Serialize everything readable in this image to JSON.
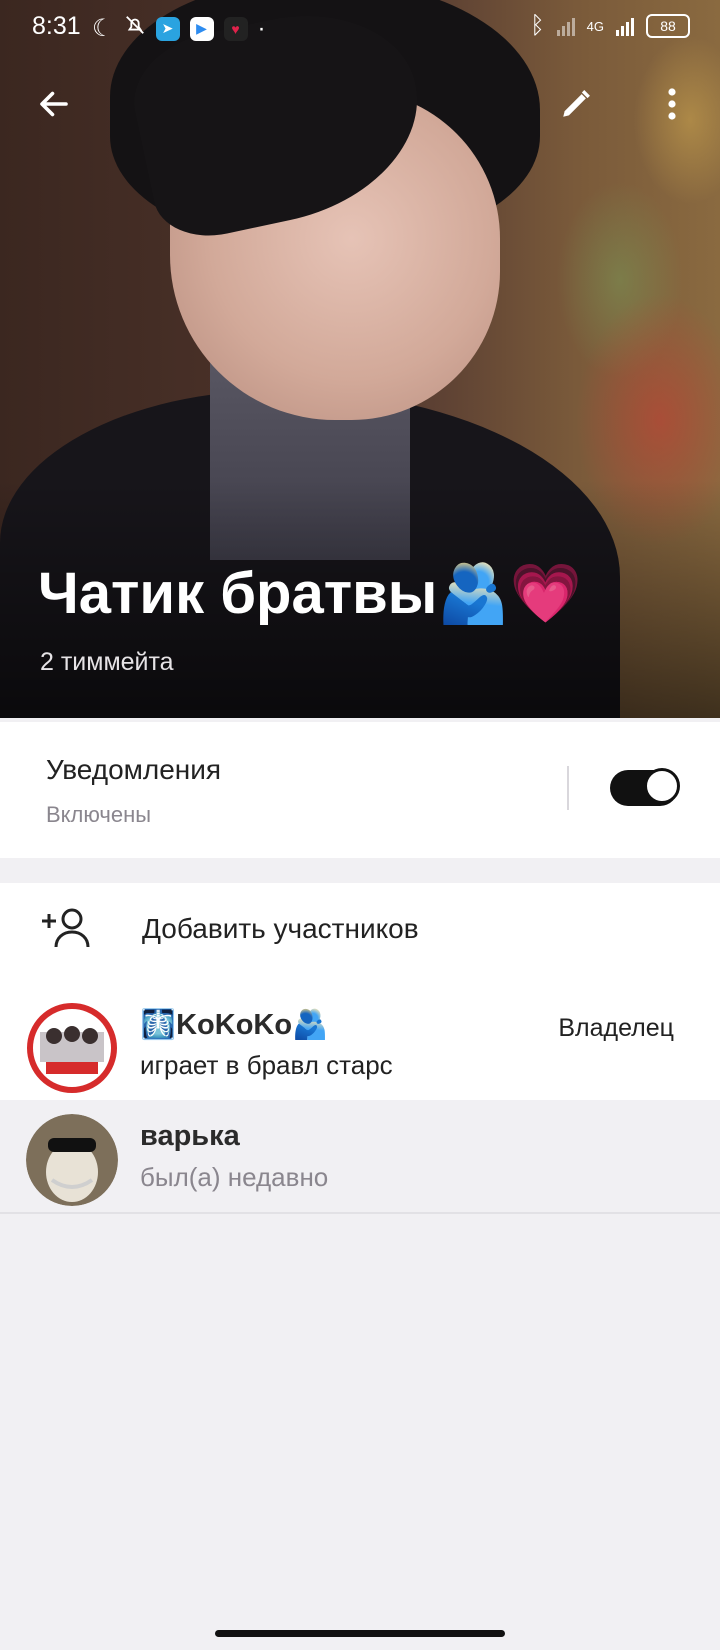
{
  "status_bar": {
    "time": "8:31",
    "network": "4G",
    "battery": "88",
    "icons": [
      "moon-icon",
      "bell-off-icon",
      "telegram-icon",
      "play-icon",
      "heart-app-icon",
      "bluetooth-icon",
      "signal-icon"
    ]
  },
  "header": {
    "back_icon": "arrow-left-icon",
    "edit_icon": "pencil-icon",
    "more_icon": "more-vertical-icon",
    "title": "Чатик братвы🫂💗",
    "subtitle": "2 тиммейта"
  },
  "notifications": {
    "label": "Уведомления",
    "value": "Включены",
    "enabled": true
  },
  "add_members": {
    "label": "Добавить участников",
    "icon": "add-person-icon"
  },
  "members": [
    {
      "name": "🩻KoKoKo🫂",
      "status": "играет в бравл старс",
      "role": "Владелец"
    },
    {
      "name": "варька",
      "status": "был(а) недавно",
      "role": ""
    }
  ],
  "colors": {
    "accent": "#111111",
    "background": "#f1f0f3",
    "secondary_text": "#8a868e"
  }
}
